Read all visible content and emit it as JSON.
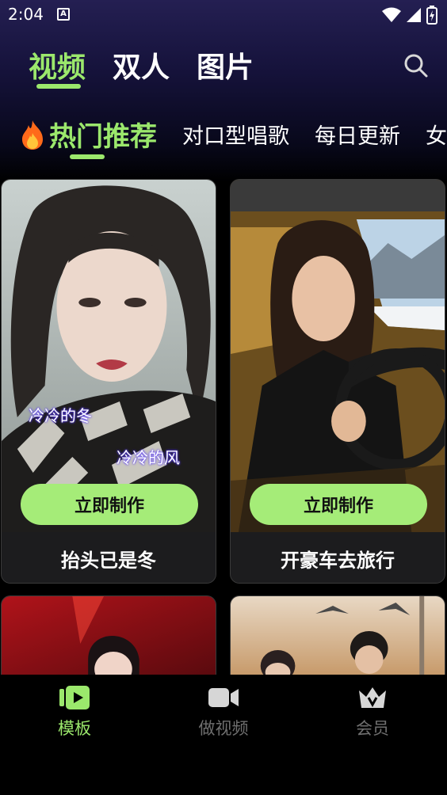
{
  "status_bar": {
    "time": "2:04",
    "notification_glyph": "A"
  },
  "main_tabs": [
    {
      "label": "视频",
      "active": true
    },
    {
      "label": "双人",
      "active": false
    },
    {
      "label": "图片",
      "active": false
    }
  ],
  "category_tabs": [
    {
      "label": "热门推荐",
      "active": true,
      "icon": "fire-icon"
    },
    {
      "label": "对口型唱歌",
      "active": false
    },
    {
      "label": "每日更新",
      "active": false
    },
    {
      "label": "女",
      "active": false
    }
  ],
  "cards": [
    {
      "title": "抬头已是冬",
      "button": "立即制作",
      "lyrics": [
        "冷冷的冬",
        "冷冷的风"
      ]
    },
    {
      "title": "开豪车去旅行",
      "button": "立即制作"
    },
    {
      "title": "",
      "button": ""
    },
    {
      "title": "",
      "button": ""
    }
  ],
  "bottom_nav": [
    {
      "label": "模板",
      "icon": "template-play-icon",
      "active": true
    },
    {
      "label": "做视频",
      "icon": "video-camera-icon",
      "active": false
    },
    {
      "label": "会员",
      "icon": "crown-icon",
      "active": false
    }
  ],
  "colors": {
    "accent": "#9be86c",
    "button": "#a5ec78",
    "card_bg": "#1c1c1e",
    "inactive": "#6f6f6f"
  }
}
